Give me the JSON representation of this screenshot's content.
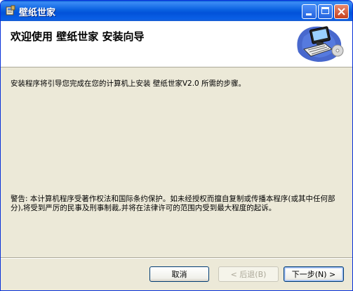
{
  "window": {
    "title": "壁纸世家",
    "controls": {
      "minimize": "minimize",
      "maximize": "maximize",
      "close": "close"
    }
  },
  "banner": {
    "title": "欢迎使用 壁纸世家 安装向导"
  },
  "body": {
    "intro": "安装程序将引导您完成在您的计算机上安装 壁纸世家V2.0 所需的步骤。",
    "warning": "警告: 本计算机程序受著作权法和国际条约保护。如未经授权而擅自复制或传播本程序(或其中任何部分),将受到严厉的民事及刑事制裁,并将在法律许可的范围内受到最大程度的起诉。"
  },
  "buttons": {
    "cancel": "取消",
    "back": "< 后退(B)",
    "next": "下一步(N) >"
  },
  "icons": {
    "app": "installer-icon",
    "banner": "computer-setup-icon"
  }
}
